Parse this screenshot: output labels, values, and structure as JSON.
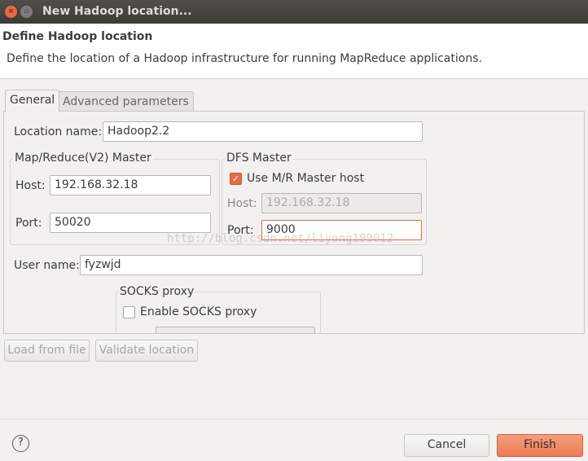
{
  "window": {
    "title": "New Hadoop location..."
  },
  "header": {
    "title": "Define Hadoop location",
    "description": "Define the location of a Hadoop infrastructure for running MapReduce applications."
  },
  "tabs": [
    {
      "label": "General"
    },
    {
      "label": "Advanced parameters"
    }
  ],
  "general": {
    "location_name_label": "Location name:",
    "location_name": "Hadoop2.2",
    "mr_master": {
      "title": "Map/Reduce(V2) Master",
      "host_label": "Host:",
      "host": "192.168.32.18",
      "port_label": "Port:",
      "port": "50020"
    },
    "dfs_master": {
      "title": "DFS Master",
      "use_mr_label": "Use M/R Master host",
      "use_mr_checked": true,
      "host_label": "Host:",
      "host": "192.168.32.18",
      "port_label": "Port:",
      "port": "9000"
    },
    "user_name_label": "User name:",
    "user_name": "fyzwjd",
    "socks": {
      "title": "SOCKS proxy",
      "enable_label": "Enable SOCKS proxy",
      "enabled": false
    }
  },
  "watermark": "http://blog.csdn.net/liyong199012",
  "buttons": {
    "load": "Load from file",
    "validate": "Validate location",
    "help": "?",
    "cancel": "Cancel",
    "finish": "Finish"
  },
  "colors": {
    "accent": "#f08a64"
  }
}
